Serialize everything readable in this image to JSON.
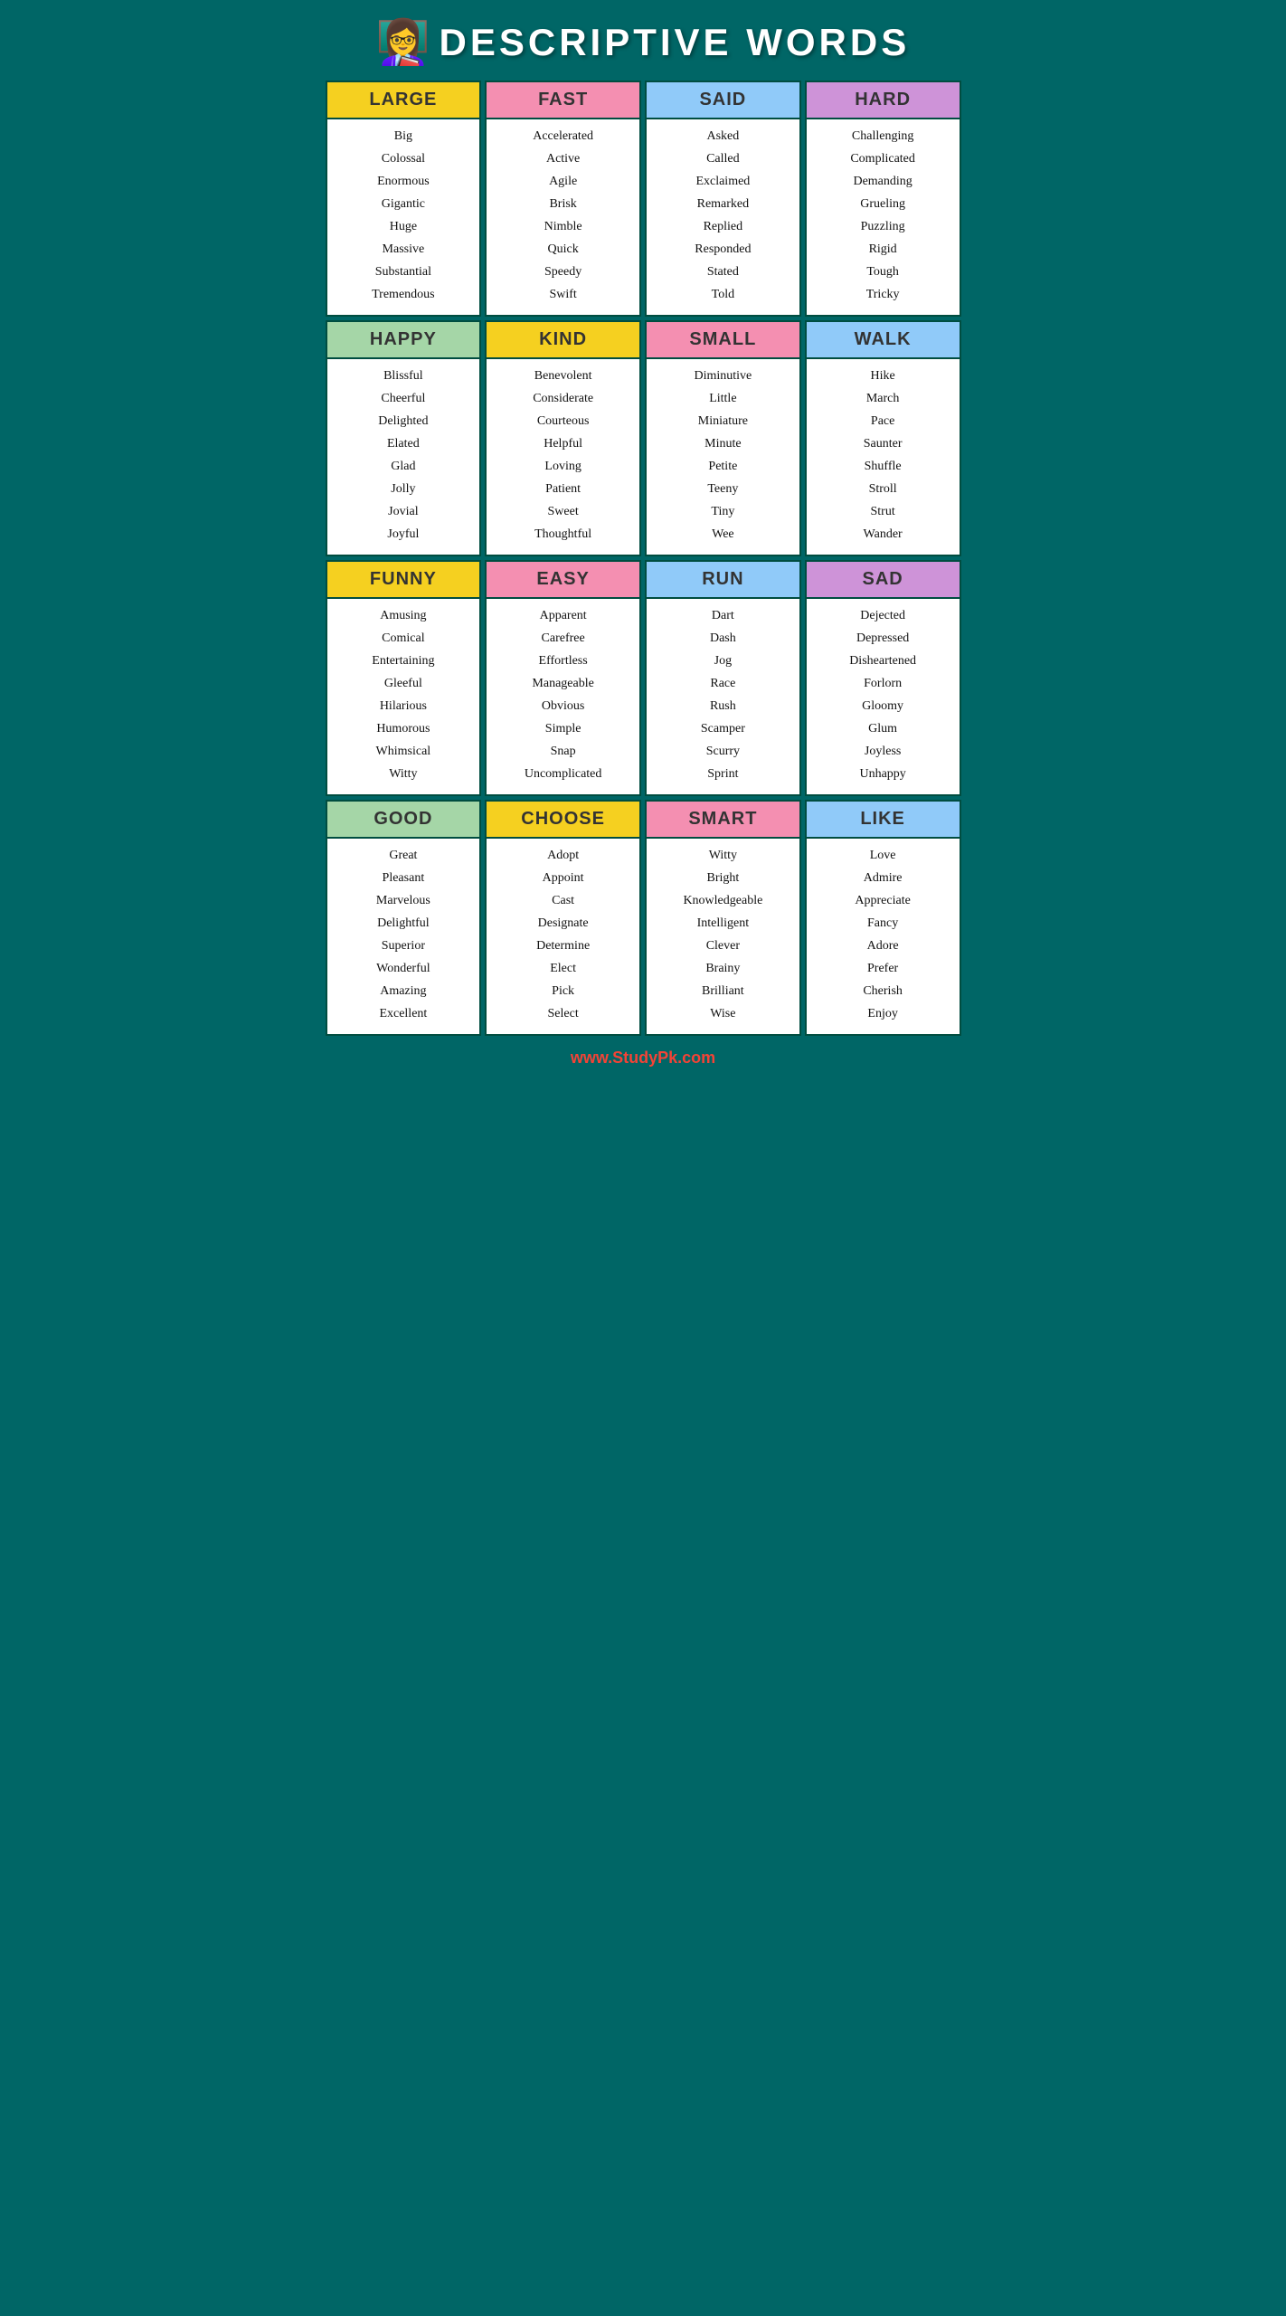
{
  "header": {
    "title": "DESCRIPTIVE WORDS",
    "icon": "👩‍🏫"
  },
  "footer": {
    "url": "www.StudyPk.com"
  },
  "grid": [
    {
      "category": "LARGE",
      "headerBg": "bg-yellow",
      "words": [
        "Big",
        "Colossal",
        "Enormous",
        "Gigantic",
        "Huge",
        "Massive",
        "Substantial",
        "Tremendous"
      ]
    },
    {
      "category": "FAST",
      "headerBg": "bg-pink",
      "words": [
        "Accelerated",
        "Active",
        "Agile",
        "Brisk",
        "Nimble",
        "Quick",
        "Speedy",
        "Swift"
      ]
    },
    {
      "category": "SAID",
      "headerBg": "bg-blue",
      "words": [
        "Asked",
        "Called",
        "Exclaimed",
        "Remarked",
        "Replied",
        "Responded",
        "Stated",
        "Told"
      ]
    },
    {
      "category": "HARD",
      "headerBg": "bg-purple",
      "words": [
        "Challenging",
        "Complicated",
        "Demanding",
        "Grueling",
        "Puzzling",
        "Rigid",
        "Tough",
        "Tricky"
      ]
    },
    {
      "category": "HAPPY",
      "headerBg": "bg-green",
      "words": [
        "Blissful",
        "Cheerful",
        "Delighted",
        "Elated",
        "Glad",
        "Jolly",
        "Jovial",
        "Joyful"
      ]
    },
    {
      "category": "KIND",
      "headerBg": "bg-yellow",
      "words": [
        "Benevolent",
        "Considerate",
        "Courteous",
        "Helpful",
        "Loving",
        "Patient",
        "Sweet",
        "Thoughtful"
      ]
    },
    {
      "category": "SMALL",
      "headerBg": "bg-pink",
      "words": [
        "Diminutive",
        "Little",
        "Miniature",
        "Minute",
        "Petite",
        "Teeny",
        "Tiny",
        "Wee"
      ]
    },
    {
      "category": "WALK",
      "headerBg": "bg-blue",
      "words": [
        "Hike",
        "March",
        "Pace",
        "Saunter",
        "Shuffle",
        "Stroll",
        "Strut",
        "Wander"
      ]
    },
    {
      "category": "FUNNY",
      "headerBg": "bg-yellow",
      "words": [
        "Amusing",
        "Comical",
        "Entertaining",
        "Gleeful",
        "Hilarious",
        "Humorous",
        "Whimsical",
        "Witty"
      ]
    },
    {
      "category": "EASY",
      "headerBg": "bg-pink",
      "words": [
        "Apparent",
        "Carefree",
        "Effortless",
        "Manageable",
        "Obvious",
        "Simple",
        "Snap",
        "Uncomplicated"
      ]
    },
    {
      "category": "RUN",
      "headerBg": "bg-blue",
      "words": [
        "Dart",
        "Dash",
        "Jog",
        "Race",
        "Rush",
        "Scamper",
        "Scurry",
        "Sprint"
      ]
    },
    {
      "category": "SAD",
      "headerBg": "bg-purple",
      "words": [
        "Dejected",
        "Depressed",
        "Disheartened",
        "Forlorn",
        "Gloomy",
        "Glum",
        "Joyless",
        "Unhappy"
      ]
    },
    {
      "category": "GOOD",
      "headerBg": "bg-green",
      "words": [
        "Great",
        "Pleasant",
        "Marvelous",
        "Delightful",
        "Superior",
        "Wonderful",
        "Amazing",
        "Excellent"
      ]
    },
    {
      "category": "CHOOSE",
      "headerBg": "bg-yellow",
      "words": [
        "Adopt",
        "Appoint",
        "Cast",
        "Designate",
        "Determine",
        "Elect",
        "Pick",
        "Select"
      ]
    },
    {
      "category": "SMART",
      "headerBg": "bg-pink",
      "words": [
        "Witty",
        "Bright",
        "Knowledgeable",
        "Intelligent",
        "Clever",
        "Brainy",
        "Brilliant",
        "Wise"
      ]
    },
    {
      "category": "LIKE",
      "headerBg": "bg-blue",
      "words": [
        "Love",
        "Admire",
        "Appreciate",
        "Fancy",
        "Adore",
        "Prefer",
        "Cherish",
        "Enjoy"
      ]
    }
  ]
}
